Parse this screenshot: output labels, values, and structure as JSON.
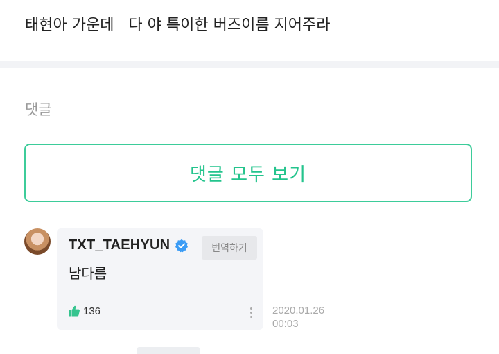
{
  "post": {
    "text": "태현아 가운데   다 야 특이한 버즈이름 지어주라"
  },
  "comments_section": {
    "heading": "댓글",
    "view_all_label": "댓글 모두 보기",
    "accent_color": "#24c48d"
  },
  "comment": {
    "author": "TXT_TAEHYUN",
    "verified_icon": "verified-badge-icon",
    "translate_label": "번역하기",
    "body": "남다름",
    "like_count": "136",
    "like_icon": "thumbs-up-icon",
    "more_icon": "more-vertical-icon",
    "date": "2020.01.26",
    "time": "00:03"
  }
}
